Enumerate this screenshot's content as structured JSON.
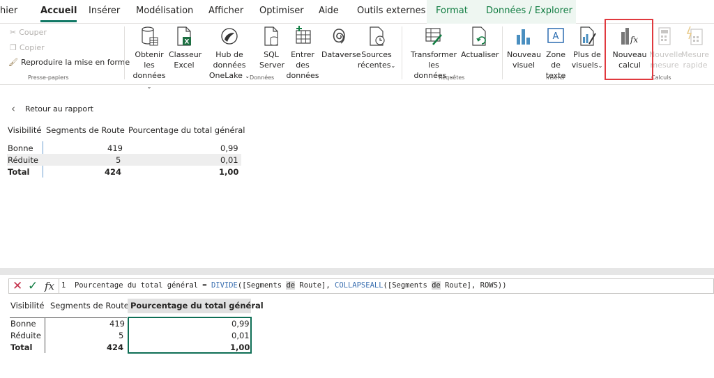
{
  "tabs": [
    {
      "label": "hier"
    },
    {
      "label": "Accueil"
    },
    {
      "label": "Insérer"
    },
    {
      "label": "Modélisation"
    },
    {
      "label": "Afficher"
    },
    {
      "label": "Optimiser"
    },
    {
      "label": "Aide"
    },
    {
      "label": "Outils externes"
    },
    {
      "label": "Format"
    },
    {
      "label": "Données / Explorer"
    }
  ],
  "ribbon": {
    "clipboard": {
      "cut": "Couper",
      "copy": "Copier",
      "format_painter": "Reproduire la mise en forme",
      "label": "Presse-papiers"
    },
    "data": {
      "label": "Données",
      "get_data": [
        "Obtenir les",
        "données"
      ],
      "excel": [
        "Classeur",
        "Excel"
      ],
      "onelake": [
        "Hub de données",
        "OneLake"
      ],
      "sql": [
        "SQL",
        "Server"
      ],
      "enter_data": [
        "Entrer des",
        "données"
      ],
      "dataverse": [
        "Dataverse"
      ],
      "recent": [
        "Sources",
        "récentes"
      ]
    },
    "queries": {
      "label": "Requêtes",
      "transform": [
        "Transformer les",
        "données"
      ],
      "refresh": [
        "Actualiser"
      ]
    },
    "insert": {
      "label": "Insérer",
      "new_visual": [
        "Nouveau",
        "visuel"
      ],
      "text_box": [
        "Zone de",
        "texte"
      ],
      "more_visuals": [
        "Plus de",
        "visuels"
      ]
    },
    "calc": {
      "label": "Calculs",
      "new_calc": [
        "Nouveau",
        "calcul"
      ],
      "new_measure": [
        "Nouvelle",
        "mesure"
      ],
      "quick_measure": [
        "Mesure",
        "rapide"
      ]
    }
  },
  "report": {
    "back_label": "Retour au rapport",
    "table": {
      "headers": [
        "Visibilité",
        "Segments de Route",
        "Pourcentage du total général"
      ],
      "rows": [
        [
          "Bonne",
          "419",
          "0,99"
        ],
        [
          "Réduite",
          "5",
          "0,01"
        ]
      ],
      "total": [
        "Total",
        "424",
        "1,00"
      ]
    }
  },
  "formula": {
    "line_no": "1",
    "text_parts": [
      {
        "t": "Pourcentage du total général = ",
        "c": "plain"
      },
      {
        "t": "DIVIDE",
        "c": "kw"
      },
      {
        "t": "([Segments ",
        "c": "plain"
      },
      {
        "t": "de",
        "c": "hl"
      },
      {
        "t": " Route], ",
        "c": "plain"
      },
      {
        "t": "COLLAPSEALL",
        "c": "kw"
      },
      {
        "t": "([Segments ",
        "c": "plain"
      },
      {
        "t": "de",
        "c": "hl"
      },
      {
        "t": " Route], ROWS))",
        "c": "plain"
      }
    ]
  },
  "visual": {
    "headers": [
      "Visibilité",
      "Segments de Route",
      "Pourcentage du total général"
    ],
    "rows": [
      [
        "Bonne",
        "419",
        "0,99"
      ],
      [
        "Réduite",
        "5",
        "0,01"
      ]
    ],
    "total": [
      "Total",
      "424",
      "1,00"
    ]
  },
  "colors": {
    "accent_green": "#117865",
    "highlight_red": "#e0393e",
    "selection_border": "#0e6e55"
  }
}
